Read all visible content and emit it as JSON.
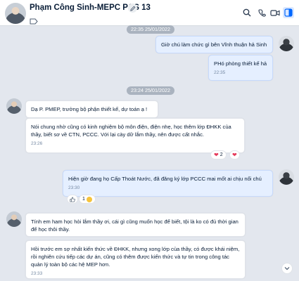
{
  "header": {
    "title": "Phạm Công Sinh-MEPC P&S 13",
    "icons": [
      "edit-icon",
      "tag-icon",
      "search-icon",
      "video-call-icon",
      "phone-icon",
      "sidebar-toggle-icon"
    ]
  },
  "dates": [
    "22:35 25/01/2022",
    "23:24 25/01/2022"
  ],
  "messages": [
    {
      "text": "Giờ chú làm chức gì bên Vĩnh thuận hả Sinh",
      "time": ""
    },
    {
      "text": "PHó phòng thiết kế hả",
      "time": "22:35"
    },
    {
      "text": "Dạ P. PMEP, trưởng bộ phận thiết kế, dự toán ạ !",
      "time": ""
    },
    {
      "text": "Nói chung nhờ cũng có kinh nghiệm bộ môn điện, điện nhẹ, học thêm lớp ĐHKK của thầy, biết sơ về CTN, PCCC. Với lại cày dữ lắm thầy, nên được cất nhắc.",
      "time": "23:26",
      "reaction_count": "2"
    },
    {
      "text": "Hiện giờ đang họ Cấp Thoát Nước, đã đăng ký lớp PCCC mai mốt ai chịu nổi chú",
      "time": "23:30",
      "reaction_count": "1"
    },
    {
      "text": "Tính em ham học hỏi lắm thầy ơi, cái gì cũng muốn học để biết, tội là ko có đủ thời gian để học thôi thầy.",
      "time": ""
    },
    {
      "text": "Hồi trước em sợ nhất kiến thức về ĐHKK, nhưng xong lớp của thầy, có được khái niệm, rồi nghiên cứu tiếp các dự án, cũng có thêm được kiến thức và tự tin trong công tác quản lý toàn bộ các hệ MEP hơn.",
      "time": "23:33"
    }
  ],
  "colors": {
    "chat_bg": "#e3e7ee",
    "mine_bubble": "#e5efff",
    "their_bubble": "#ffffff",
    "accent": "#0068ff",
    "heart": "#e5395a"
  }
}
